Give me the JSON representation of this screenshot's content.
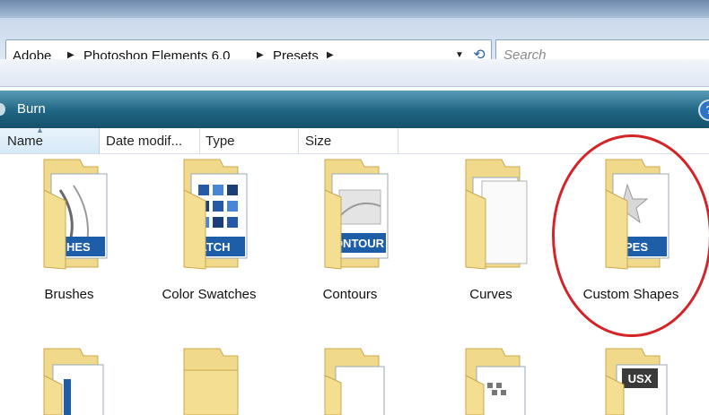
{
  "breadcrumb": [
    "Adobe",
    "Photoshop Elements 6.0",
    "Presets"
  ],
  "search": {
    "placeholder": "Search"
  },
  "command_bar": {
    "burn_label": "Burn",
    "help_label": "?"
  },
  "columns": [
    "Name",
    "Date modif...",
    "Type",
    "Size"
  ],
  "folders_row1": [
    {
      "label": "Brushes",
      "tag": "SHES",
      "icon": "brushes-folder-icon"
    },
    {
      "label": "Color Swatches",
      "tag": "ATCH",
      "icon": "color-swatches-folder-icon"
    },
    {
      "label": "Contours",
      "tag": "ONTOUR",
      "icon": "contours-folder-icon"
    },
    {
      "label": "Curves",
      "tag": "",
      "icon": "curves-folder-icon"
    },
    {
      "label": "Custom Shapes",
      "tag": "PES",
      "icon": "custom-shapes-folder-icon"
    }
  ],
  "folders_row2_tag": "USX",
  "highlight_color": "#d42428"
}
